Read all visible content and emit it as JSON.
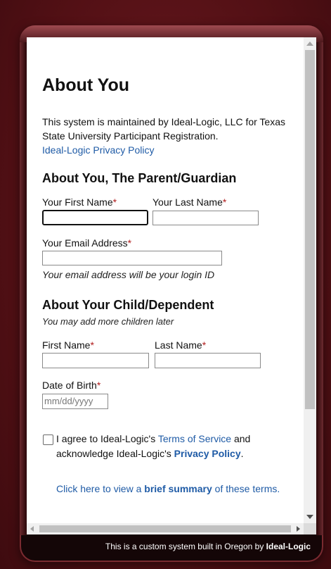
{
  "heading": "About You",
  "intro": {
    "text": "This system is maintained by Ideal-Logic, LLC for Texas State University Participant Registration.",
    "privacy_link": "Ideal-Logic Privacy Policy"
  },
  "parent_section": {
    "title": "About You, The Parent/Guardian",
    "first_name_label": "Your First Name",
    "last_name_label": "Your Last Name",
    "email_label": "Your Email Address",
    "email_hint": "Your email address will be your login ID",
    "required_marker": "*"
  },
  "child_section": {
    "title": "About Your Child/Dependent",
    "subtitle": "You may add more children later",
    "first_name_label": "First Name",
    "last_name_label": "Last Name",
    "dob_label": "Date of Birth",
    "dob_placeholder": "mm/dd/yyyy"
  },
  "terms": {
    "prefix": "I agree to Ideal-Logic's ",
    "tos_link": "Terms of Service",
    "middle": " and acknowledge Ideal-Logic's ",
    "privacy_link": "Privacy Policy",
    "suffix": ".",
    "summary_prefix": "Click here to view a ",
    "summary_link": "brief summary",
    "summary_suffix": " of these terms."
  },
  "footer": {
    "text": "This is a custom system built in Oregon by ",
    "brand": "Ideal-Logic"
  }
}
